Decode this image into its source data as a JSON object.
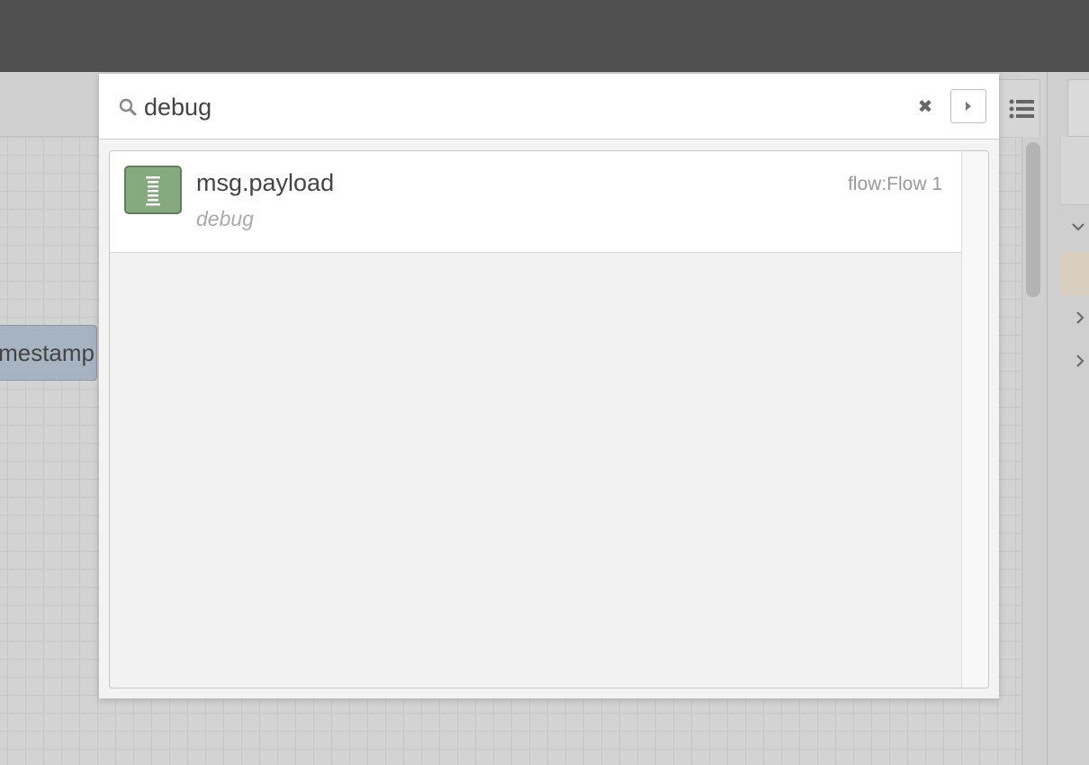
{
  "canvas": {
    "node_label": "mestamp"
  },
  "search": {
    "query": "debug",
    "clear_icon": "✖"
  },
  "results": [
    {
      "title": "msg.payload",
      "type": "debug",
      "flow": "flow:Flow 1",
      "icon": "debug-icon",
      "color": "#87a980"
    }
  ],
  "colors": {
    "header": "#505050",
    "debug_node": "#87a980",
    "timestamp_node": "#a6b3c0",
    "sidebar_highlight": "#d8cfbf"
  },
  "icons": {
    "search": "search-icon",
    "clear": "close-icon",
    "next": "caret-right-icon",
    "list": "list-icon",
    "sidebar_chevrons": [
      "chevron-down-icon",
      "chevron-right-icon",
      "chevron-right-icon"
    ]
  }
}
